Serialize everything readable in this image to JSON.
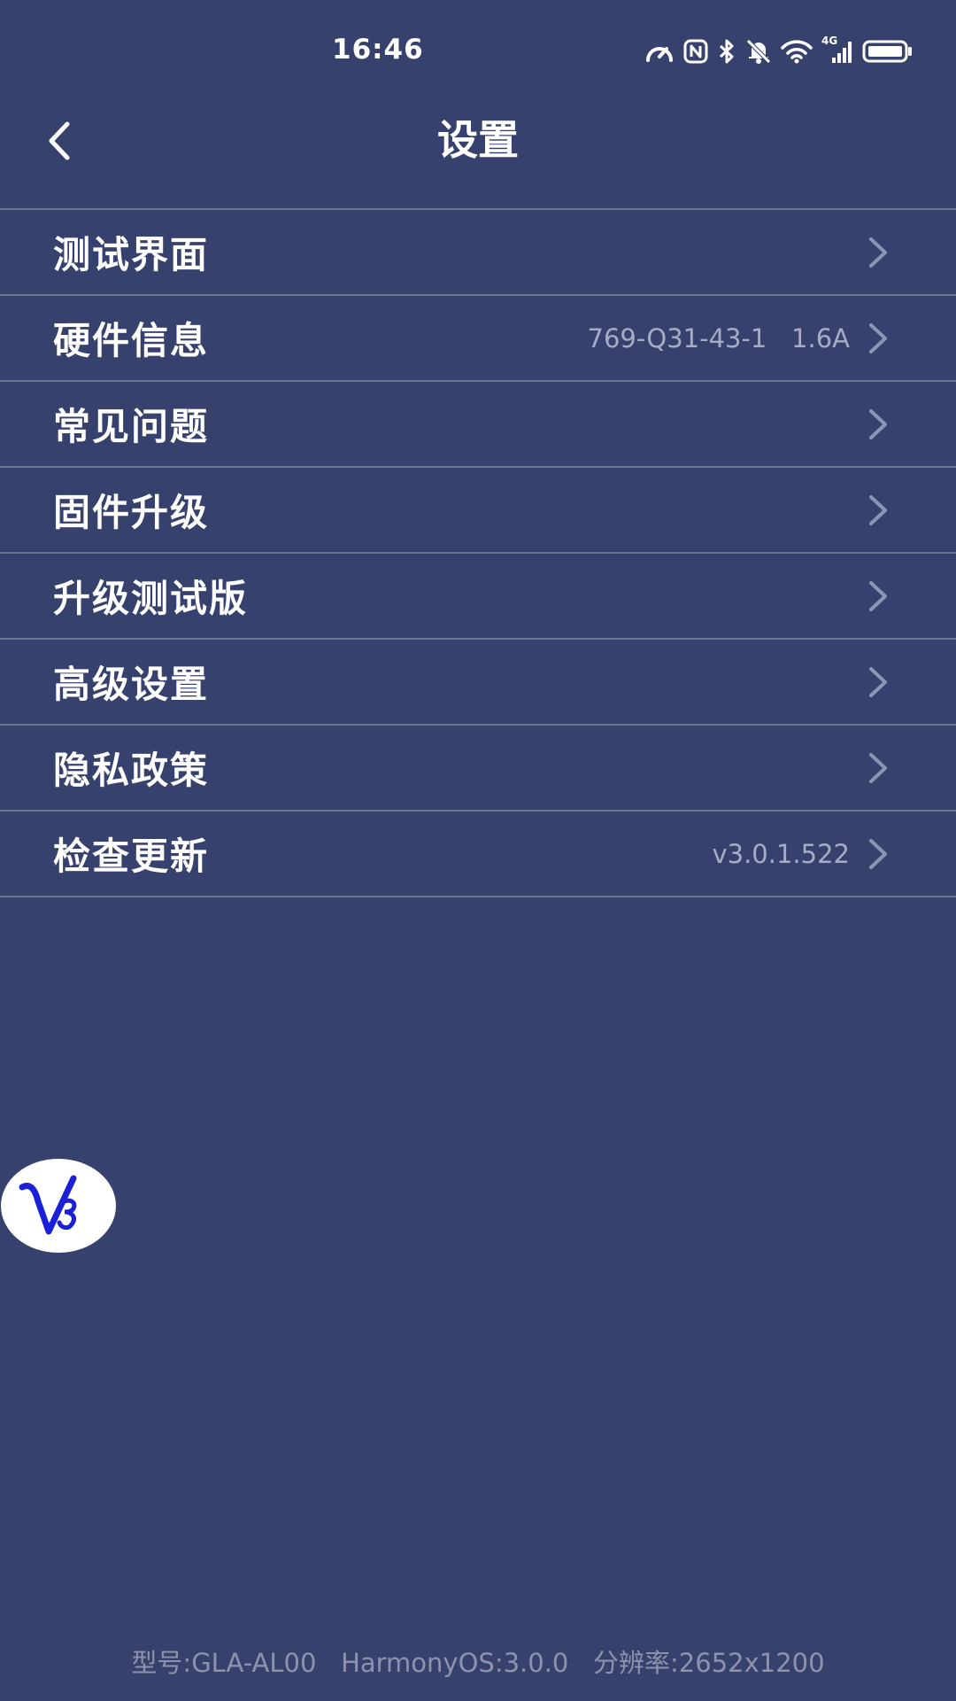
{
  "status_bar": {
    "time": "16:46",
    "icons": [
      "speed-meter-icon",
      "nfc-icon",
      "bluetooth-icon",
      "mute-bell-icon",
      "wifi-icon",
      "4g-signal-icon",
      "battery-icon"
    ],
    "network_label": "4G"
  },
  "header": {
    "back_icon": "chevron-left-icon",
    "title": "设置"
  },
  "menu": [
    {
      "label": "测试界面",
      "value": ""
    },
    {
      "label": "硬件信息",
      "value": "769-Q31-43-1   1.6A"
    },
    {
      "label": "常见问题",
      "value": ""
    },
    {
      "label": "固件升级",
      "value": ""
    },
    {
      "label": "升级测试版",
      "value": ""
    },
    {
      "label": "高级设置",
      "value": ""
    },
    {
      "label": "隐私政策",
      "value": ""
    },
    {
      "label": "检查更新",
      "value": "v3.0.1.522"
    }
  ],
  "floating_logo": {
    "icon": "v3-logo-icon"
  },
  "footer": {
    "info": "型号:GLA-AL00   HarmonyOS:3.0.0   分辨率:2652x1200"
  },
  "colors": {
    "background": "#37416d",
    "divider": "#6c7494",
    "secondary_text": "#a5adc6",
    "chevron": "#8b95b5",
    "logo_blue": "#1a1fd8"
  }
}
